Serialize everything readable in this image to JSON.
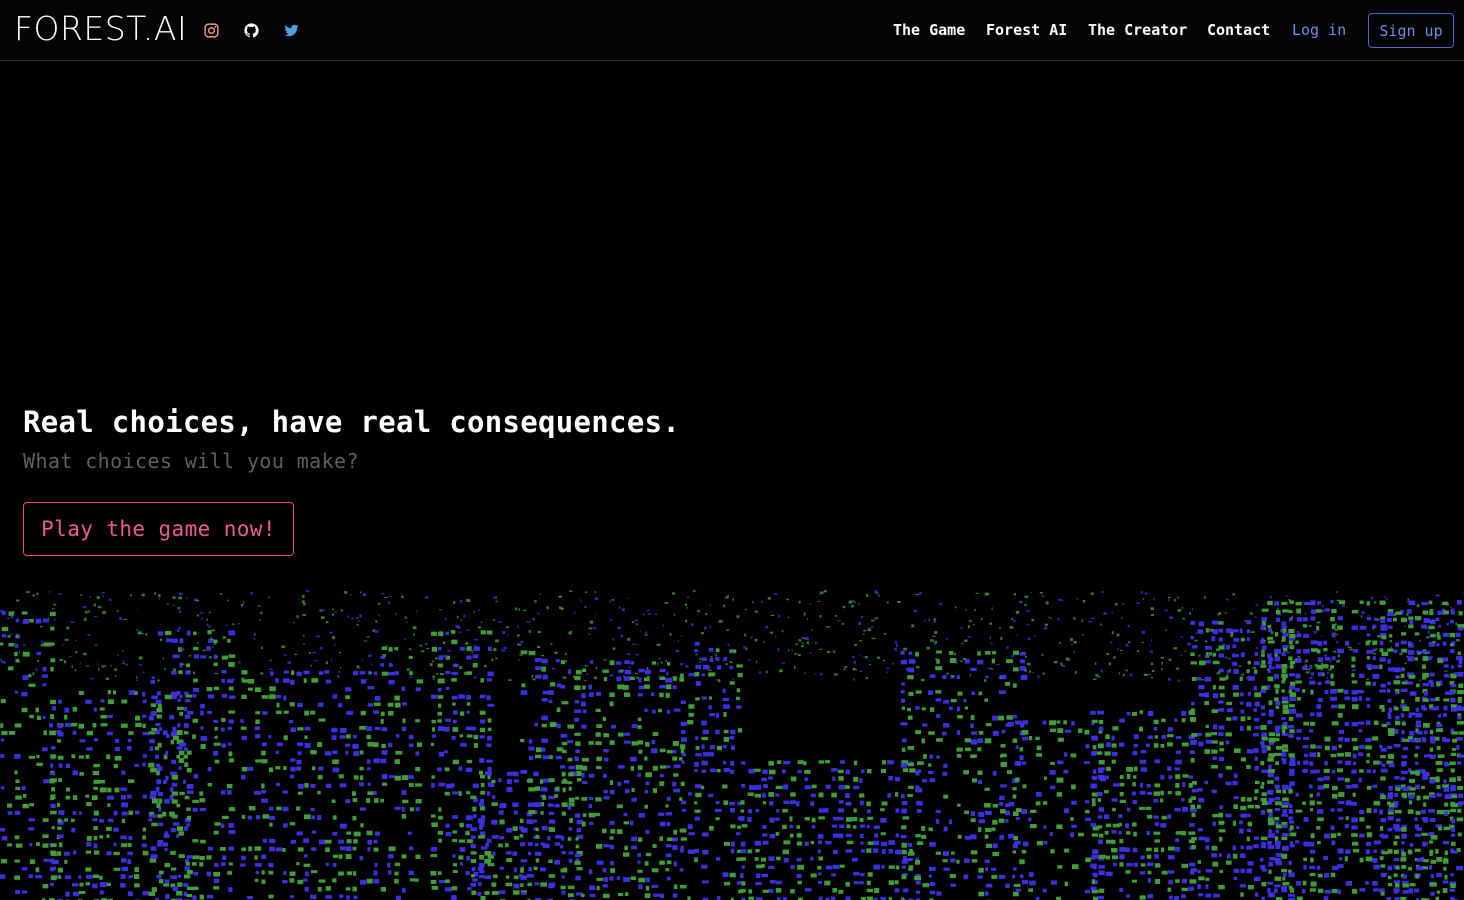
{
  "brand": {
    "logo_text": "FOREST.AI"
  },
  "social": [
    {
      "name": "instagram-icon",
      "color": "#e8a07a"
    },
    {
      "name": "github-icon",
      "color": "#ffffff"
    },
    {
      "name": "twitter-icon",
      "color": "#4aa3e8"
    }
  ],
  "nav": {
    "items": [
      "The Game",
      "Forest AI",
      "The Creator",
      "Contact"
    ],
    "login_label": "Log in",
    "signup_label": "Sign up"
  },
  "hero": {
    "title": "Real choices, have real consequences.",
    "subtitle": "What choices will you make?",
    "cta_label": "Play the game now!"
  },
  "colors": {
    "accent_pink": "#e84a8e",
    "accent_blue": "#4d68c8",
    "city_green": "#3f9d3a",
    "city_blue": "#3b30e0"
  }
}
